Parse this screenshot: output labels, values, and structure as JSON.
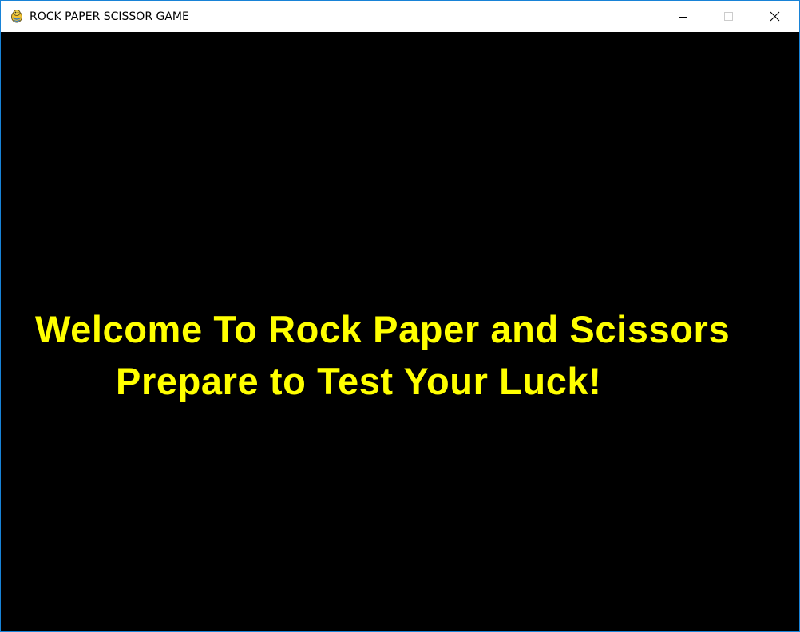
{
  "window": {
    "title": "ROCK PAPER SCISSOR GAME",
    "icon": "pygame-snake-icon",
    "border_color": "#1883d7",
    "controls": {
      "minimize_icon": "minimize-icon",
      "maximize_icon": "maximize-icon",
      "close_icon": "close-icon"
    }
  },
  "game": {
    "background_color": "#000000",
    "text_color": "#ffff00",
    "welcome_text": "Welcome To Rock Paper and Scissors",
    "prepare_text": "Prepare to Test Your Luck!"
  }
}
